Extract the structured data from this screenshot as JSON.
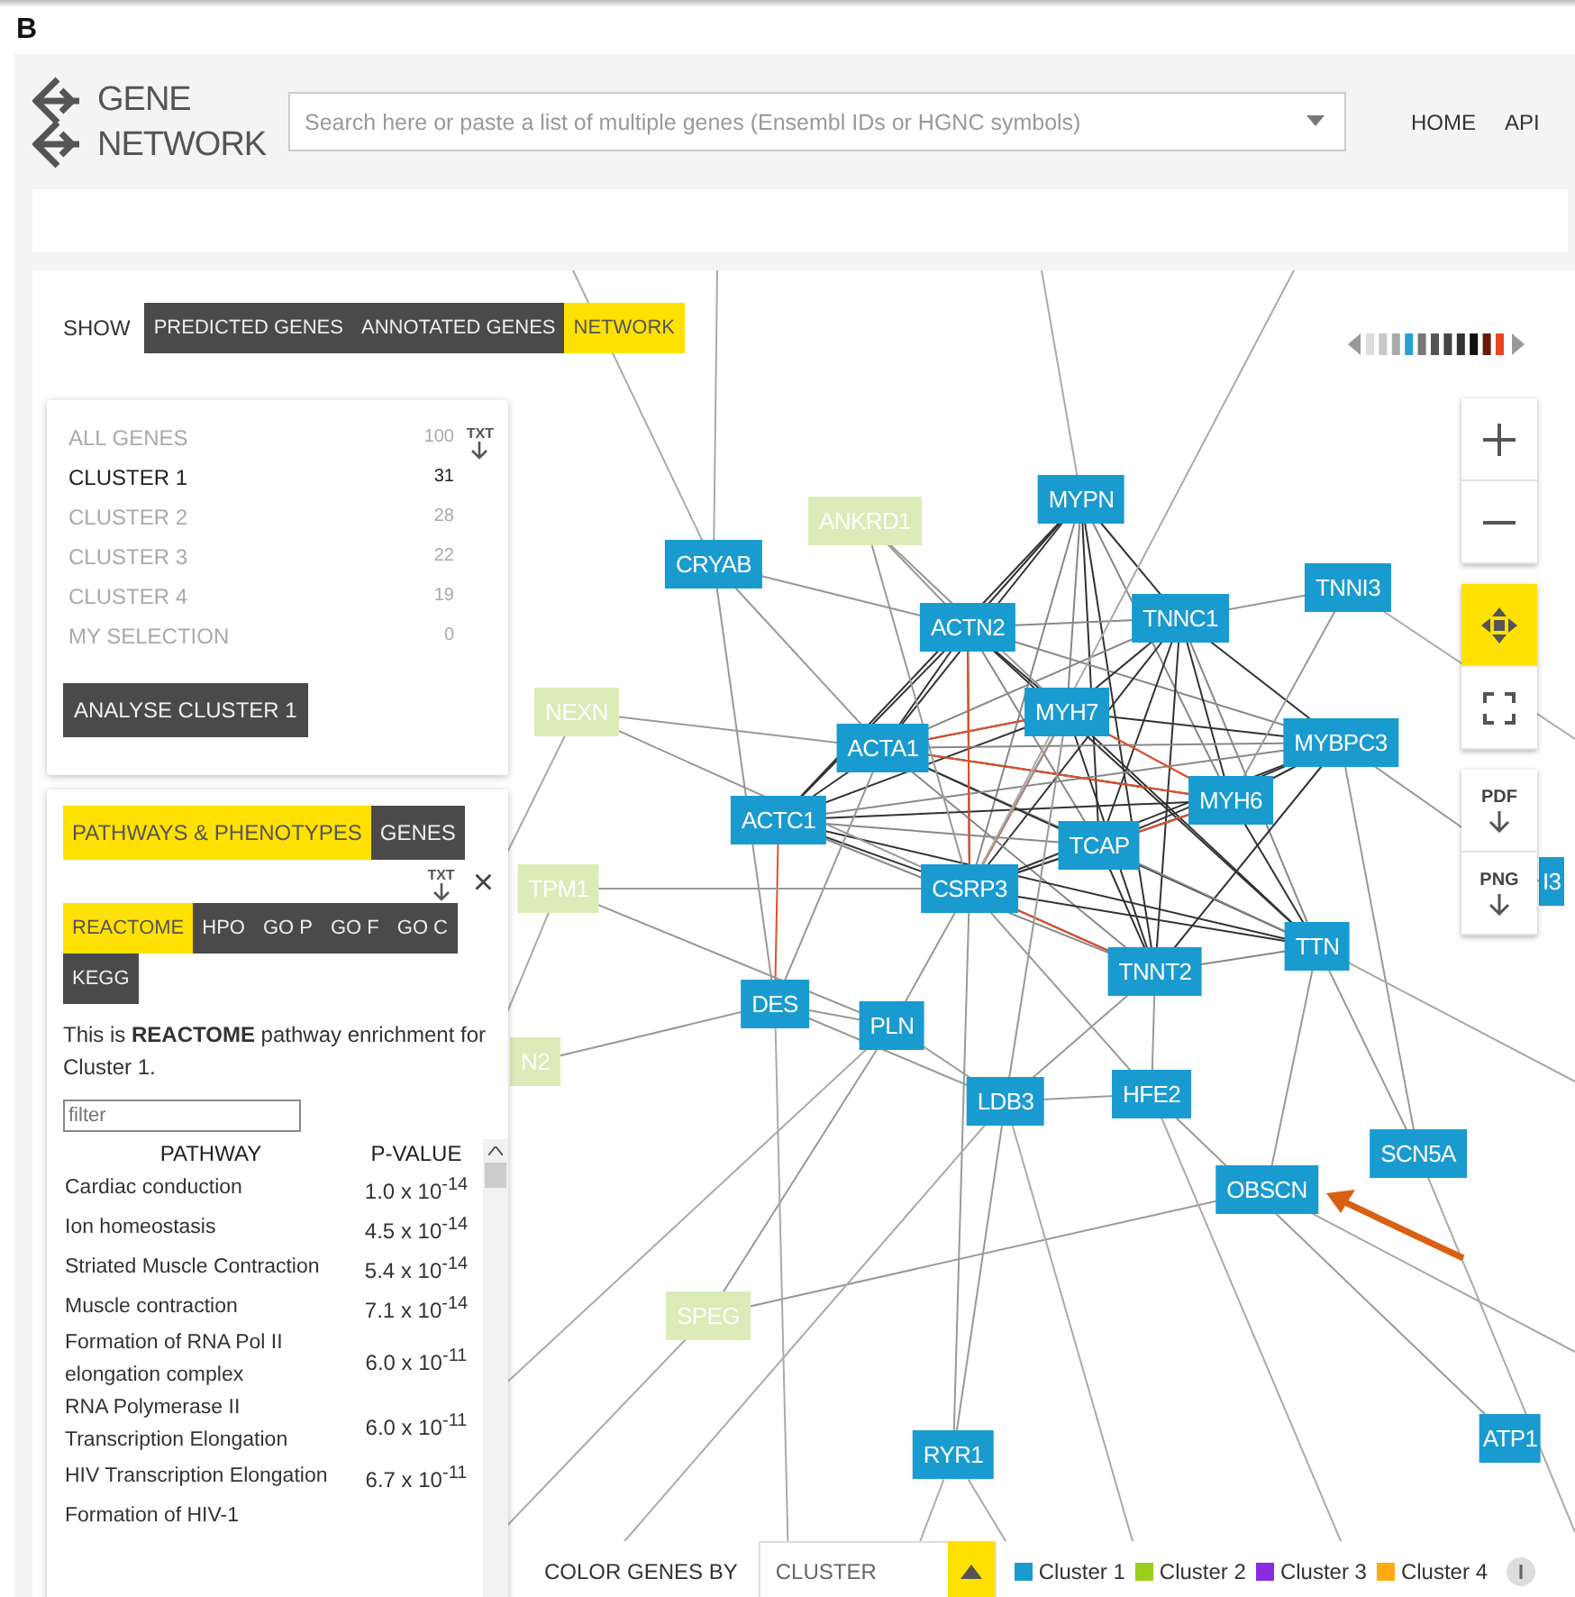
{
  "figure_label": "B",
  "header": {
    "logo_lines": [
      "GENE",
      "NETWORK"
    ],
    "search": {
      "placeholder": "Search here or paste a list of multiple genes (Ensembl IDs or HGNC symbols)"
    },
    "nav": [
      "HOME",
      "API"
    ]
  },
  "show_bar": {
    "label": "SHOW",
    "tabs": [
      {
        "label": "PREDICTED GENES",
        "selected": false
      },
      {
        "label": "ANNOTATED GENES",
        "selected": false
      },
      {
        "label": "NETWORK",
        "selected": true
      }
    ]
  },
  "clusters": {
    "items": [
      {
        "name": "ALL GENES",
        "count": "100",
        "selected": false
      },
      {
        "name": "CLUSTER 1",
        "count": "31",
        "selected": true
      },
      {
        "name": "CLUSTER 2",
        "count": "28",
        "selected": false
      },
      {
        "name": "CLUSTER 3",
        "count": "22",
        "selected": false
      },
      {
        "name": "CLUSTER 4",
        "count": "19",
        "selected": false
      },
      {
        "name": "MY SELECTION",
        "count": "0",
        "selected": false
      }
    ],
    "download": "TXT",
    "button": "ANALYSE CLUSTER 1"
  },
  "enrichment": {
    "tabs": [
      {
        "label": "PATHWAYS & PHENOTYPES",
        "selected": true
      },
      {
        "label": "GENES",
        "selected": false
      }
    ],
    "download": "TXT",
    "close": "×",
    "sources": [
      {
        "label": "REACTOME",
        "selected": true
      },
      {
        "label": "HPO",
        "selected": false
      },
      {
        "label": "GO P",
        "selected": false
      },
      {
        "label": "GO F",
        "selected": false
      },
      {
        "label": "GO C",
        "selected": false
      },
      {
        "label": "KEGG",
        "selected": false
      }
    ],
    "description": "This is **REACTOME** pathway enrichment for Cluster 1.",
    "filter": {
      "placeholder": "filter"
    },
    "columns": [
      "PATHWAY",
      "P-VALUE"
    ],
    "rows": [
      {
        "pathway": "Cardiac conduction",
        "p_value": "1.0 x 10$^{-14}$"
      },
      {
        "pathway": "Ion homeostasis",
        "p_value": "4.5 x 10$^{-14}$"
      },
      {
        "pathway": "Striated Muscle Contraction",
        "p_value": "5.4 x 10$^{-14}$"
      },
      {
        "pathway": "Muscle contraction",
        "p_value": "7.1 x 10$^{-14}$"
      },
      {
        "pathway": "Formation of RNA Pol II elongation complex",
        "p_value": "6.0 x 10$^{-11}$"
      },
      {
        "pathway": "RNA Polymerase II Transcription Elongation",
        "p_value": "6.0 x 10$^{-11}$"
      },
      {
        "pathway": "HIV Transcription Elongation",
        "p_value": "6.7 x 10$^{-11}$"
      },
      {
        "pathway": "Formation of HIV-1"
      }
    ]
  },
  "network": {
    "nodes": [
      {
        "label": "CRYAB",
        "color": "#1a9bd0"
      },
      {
        "label": "ANKRD1",
        "color": "#dcebb8"
      },
      {
        "label": "MYPN",
        "color": "#1a9bd0"
      },
      {
        "label": "TNNI3",
        "color": "#1a9bd0"
      },
      {
        "label": "ACTN2",
        "color": "#1a9bd0"
      },
      {
        "label": "TNNC1",
        "color": "#1a9bd0"
      },
      {
        "label": "MYH7",
        "color": "#1a9bd0"
      },
      {
        "label": "ACTA1",
        "color": "#1a9bd0"
      },
      {
        "label": "MYBPC3",
        "color": "#1a9bd0"
      },
      {
        "label": "MYH6",
        "color": "#1a9bd0"
      },
      {
        "label": "ACTC1",
        "color": "#1a9bd0"
      },
      {
        "label": "TCAP",
        "color": "#1a9bd0"
      },
      {
        "label": "CSRP3",
        "color": "#1a9bd0"
      },
      {
        "label": "TTN",
        "color": "#1a9bd0"
      },
      {
        "label": "TNNT2",
        "color": "#1a9bd0"
      },
      {
        "label": "DES",
        "color": "#1a9bd0"
      },
      {
        "label": "PLN",
        "color": "#1a9bd0"
      },
      {
        "label": "HFE2",
        "color": "#1a9bd0"
      },
      {
        "label": "LDB3",
        "color": "#1a9bd0"
      },
      {
        "label": "SCN5A",
        "color": "#1a9bd0"
      },
      {
        "label": "OBSCN",
        "color": "#1a9bd0"
      },
      {
        "label": "RYR1",
        "color": "#1a9bd0"
      },
      {
        "label": "ATP1",
        "color": "#1a9bd0"
      },
      {
        "label": "NEXN",
        "color": "#dcebb8"
      },
      {
        "label": "TPM1",
        "color": "#dcebb8"
      },
      {
        "label": "N2",
        "color": "#dcebb8"
      },
      {
        "label": "SPEG",
        "color": "#dcebb8"
      },
      {
        "label": "I3",
        "color": "#1a9bd0"
      }
    ]
  },
  "exports": [
    "PDF",
    "PNG"
  ],
  "color_by": {
    "label": "COLOR GENES BY",
    "value": "CLUSTER",
    "legend": [
      {
        "label": "Cluster 1",
        "color": "#1a9bd0"
      },
      {
        "label": "Cluster 2",
        "color": "#9acd1e"
      },
      {
        "label": "Cluster 3",
        "color": "#8a2be2"
      },
      {
        "label": "Cluster 4",
        "color": "#ffaa14"
      }
    ]
  }
}
